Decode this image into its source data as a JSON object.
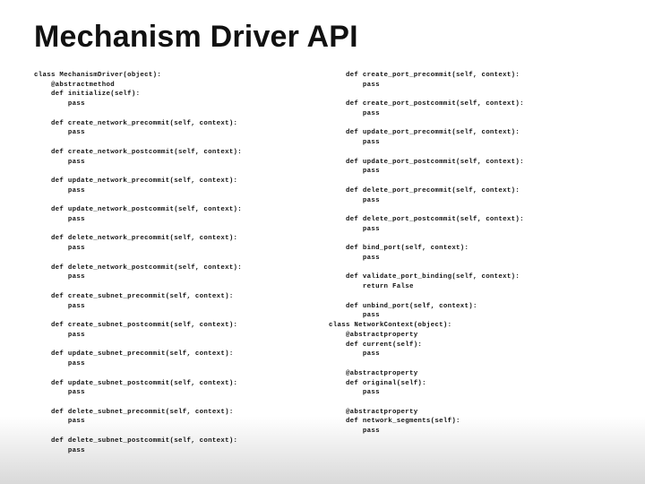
{
  "title": "Mechanism Driver API",
  "code_left": "class MechanismDriver(object):\n    @abstractmethod\n    def initialize(self):\n        pass\n\n    def create_network_precommit(self, context):\n        pass\n\n    def create_network_postcommit(self, context):\n        pass\n\n    def update_network_precommit(self, context):\n        pass\n\n    def update_network_postcommit(self, context):\n        pass\n\n    def delete_network_precommit(self, context):\n        pass\n\n    def delete_network_postcommit(self, context):\n        pass\n\n    def create_subnet_precommit(self, context):\n        pass\n\n    def create_subnet_postcommit(self, context):\n        pass\n\n    def update_subnet_precommit(self, context):\n        pass\n\n    def update_subnet_postcommit(self, context):\n        pass\n\n    def delete_subnet_precommit(self, context):\n        pass\n\n    def delete_subnet_postcommit(self, context):\n        pass",
  "code_right": "    def create_port_precommit(self, context):\n        pass\n\n    def create_port_postcommit(self, context):\n        pass\n\n    def update_port_precommit(self, context):\n        pass\n\n    def update_port_postcommit(self, context):\n        pass\n\n    def delete_port_precommit(self, context):\n        pass\n\n    def delete_port_postcommit(self, context):\n        pass\n\n    def bind_port(self, context):\n        pass\n\n    def validate_port_binding(self, context):\n        return False\n\n    def unbind_port(self, context):\n        pass\nclass NetworkContext(object):\n    @abstractproperty\n    def current(self):\n        pass\n\n    @abstractproperty\n    def original(self):\n        pass\n\n    @abstractproperty\n    def network_segments(self):\n        pass"
}
